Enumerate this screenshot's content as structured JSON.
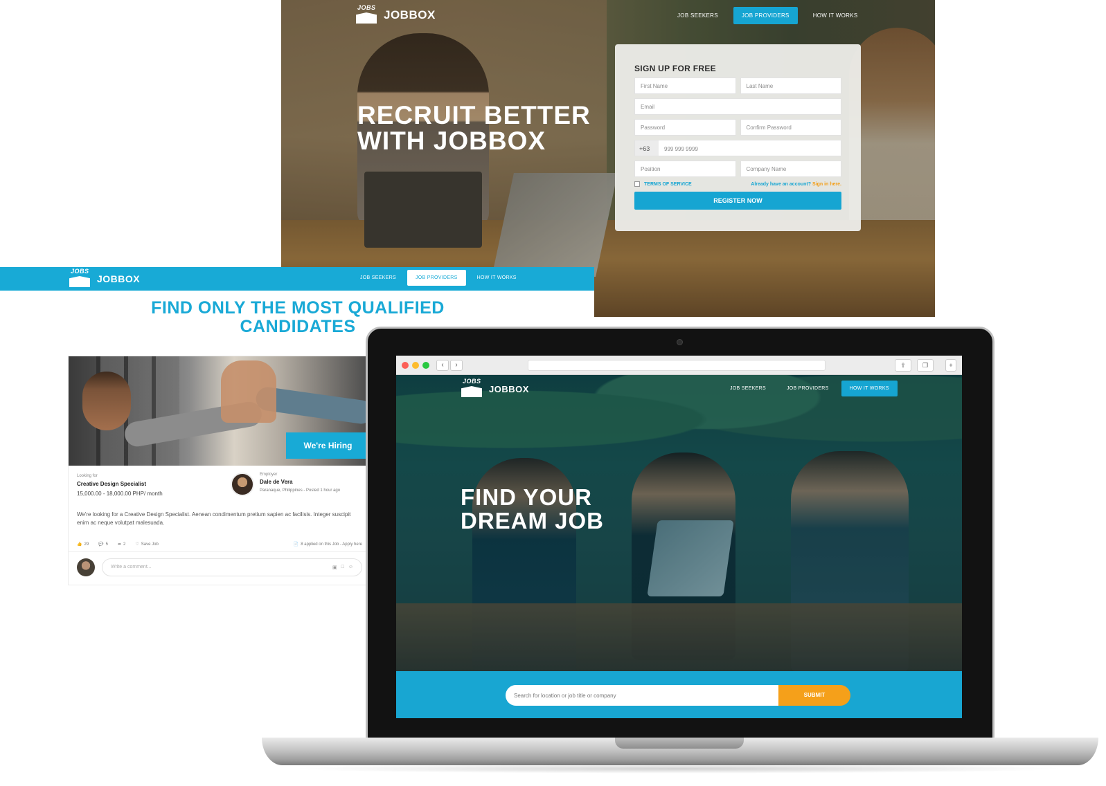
{
  "brand": {
    "logo_badge": "JOBS",
    "logo_word": "JOBBOX"
  },
  "top_panel": {
    "nav": [
      "JOB SEEKERS",
      "JOB PROVIDERS",
      "HOW IT WORKS"
    ],
    "active_nav": "JOB PROVIDERS",
    "hero_line1": "RECRUIT BETTER",
    "hero_line2": "WITH JOBBOX",
    "signup": {
      "title": "SIGN UP FOR FREE",
      "first_name": "First Name",
      "last_name": "Last Name",
      "email": "Email",
      "password": "Password",
      "confirm_password": "Confirm Password",
      "phone_code": "+63",
      "phone_placeholder": "999 999 9999",
      "position": "Position",
      "company": "Company Name",
      "terms": "TERMS OF SERVICE",
      "account_text": "Already have an account?",
      "signin_link": "Sign in here.",
      "register": "REGISTER NOW"
    }
  },
  "mid_panel": {
    "nav": [
      "JOB SEEKERS",
      "JOB PROVIDERS",
      "HOW IT WORKS"
    ],
    "active_nav": "JOB PROVIDERS",
    "title_line1": "FIND ONLY THE MOST QUALIFIED",
    "title_line2": "CANDIDATES",
    "job": {
      "hiring_badge": "We're Hiring",
      "looking_for_label": "Looking for",
      "position": "Creative Design Specialist",
      "salary": "15,000.00 -   18,000.00 PHP/ month",
      "employer_label": "Employer",
      "employer_name": "Dale de Vera",
      "employer_meta": "Paranaque, Philippines - Posted 1 hour ago",
      "description": "We're looking for a Creative Design Specialist. Aenean condimentum pretium sapien ac facilisis. Integer suscipit enim ac neque volutpat malesuada.",
      "likes": "29",
      "comments": "5",
      "shares": "2",
      "save": "Save Job",
      "applied": "8 applied on this Job - Apply here",
      "comment_placeholder": "Write a comment..."
    }
  },
  "laptop": {
    "nav": [
      "JOB SEEKERS",
      "JOB PROVIDERS",
      "HOW IT WORKS"
    ],
    "active_nav": "HOW IT WORKS",
    "hero_line1": "FIND YOUR",
    "hero_line2": "DREAM JOB",
    "search_placeholder": "Search for location or job title or company",
    "submit": "SUBMIT"
  },
  "colors": {
    "brand_blue": "#18aad6",
    "accent_orange": "#f5a01a",
    "window_red": "#fc5f57",
    "window_yellow": "#fdbc2e",
    "window_green": "#28c840"
  }
}
